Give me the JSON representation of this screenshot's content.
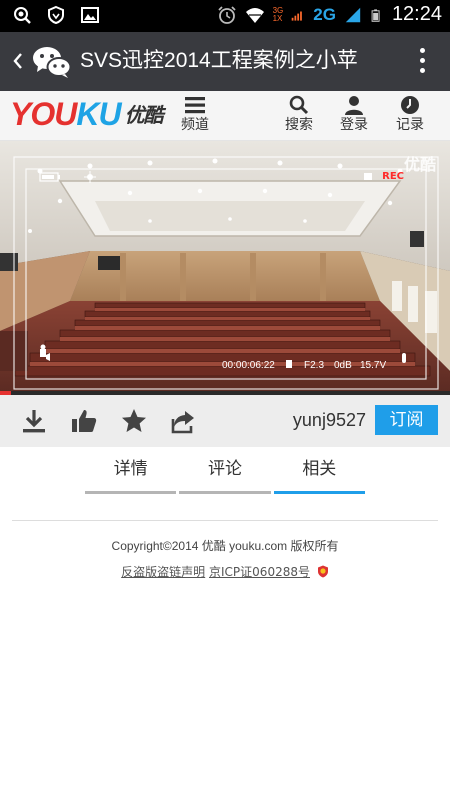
{
  "status_bar": {
    "network_small_top": "3G",
    "network_small_bottom": "1X",
    "network": "2G",
    "time": "12:24",
    "icons": [
      "search-icon",
      "shield-icon",
      "image-icon",
      "alarm-icon",
      "wifi-icon",
      "signal-icon",
      "battery-icon"
    ]
  },
  "wechat": {
    "title": "SVS迅控2014工程案例之小苹",
    "icons": [
      "back-chevron-icon",
      "wechat-logo-icon",
      "more-vertical-icon"
    ]
  },
  "youku": {
    "logo_you": "YOU",
    "logo_ku": "KU",
    "logo_cn": "优酷",
    "nav": {
      "channels": "频道",
      "search": "搜索",
      "login": "登录",
      "history": "记录"
    }
  },
  "video": {
    "watermark": "优酷",
    "rec": "REC",
    "timecode": "00:00:06:22",
    "fstop": "F2.3",
    "audio": "0dB",
    "voltage": "15.7V",
    "progress": 0.025,
    "accent_color": "#e5312f"
  },
  "actions": {
    "uploader": "yunj9527",
    "subscribe": "订阅",
    "icons": [
      "download-icon",
      "thumbs-up-icon",
      "star-icon",
      "share-icon"
    ]
  },
  "tabs": [
    {
      "label": "详情",
      "active": false
    },
    {
      "label": "评论",
      "active": false
    },
    {
      "label": "相关",
      "active": true
    }
  ],
  "footer": {
    "copyright": "Copyright©2014 优酷 youku.com 版权所有",
    "link_piracy": "反盗版盗链声明",
    "link_icp": "京ICP证060288号"
  },
  "colors": {
    "accent_blue": "#1f9ee9",
    "youku_red": "#e5312f",
    "header_bg": "#393a3f"
  }
}
